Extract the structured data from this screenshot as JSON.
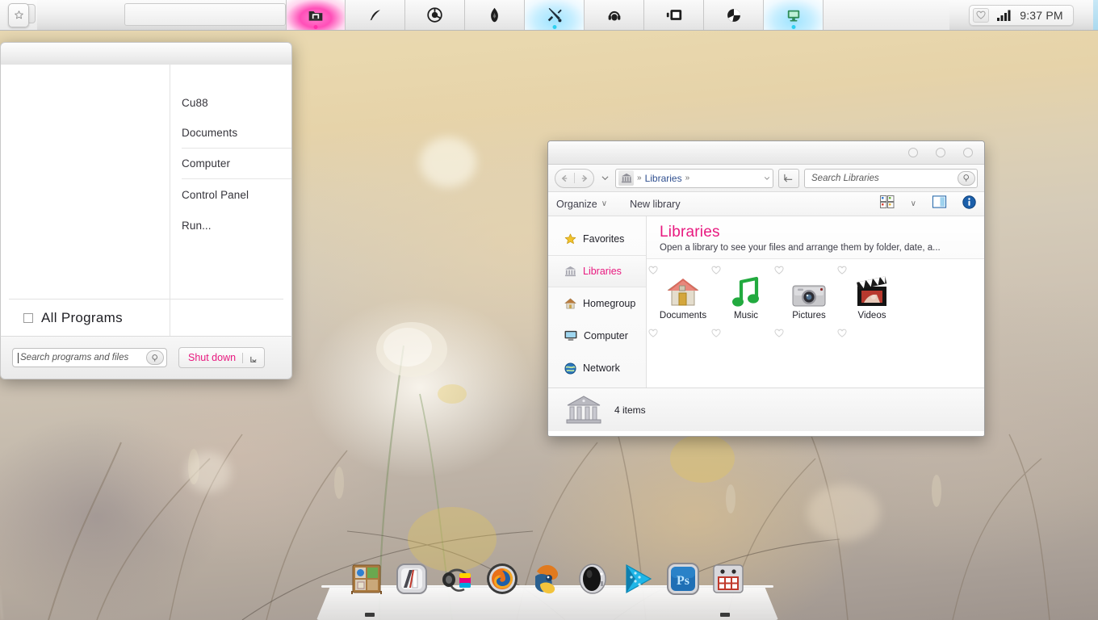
{
  "taskbar": {
    "start_button": {
      "name": "start-orb",
      "icon": "star-icon"
    },
    "buttons": [
      {
        "icon": "folder-icon",
        "label": "Explorer",
        "state": "active-pink"
      },
      {
        "icon": "feather-icon",
        "label": "Notes",
        "state": "normal"
      },
      {
        "icon": "chrome-icon",
        "label": "Chrome",
        "state": "normal"
      },
      {
        "icon": "flame-icon",
        "label": "Flame",
        "state": "normal"
      },
      {
        "icon": "tools-icon",
        "label": "Tools",
        "state": "active-blue"
      },
      {
        "icon": "headset-icon",
        "label": "Media",
        "state": "normal"
      },
      {
        "icon": "window-icon",
        "label": "Switcher",
        "state": "normal"
      },
      {
        "icon": "shutter-icon",
        "label": "Capture",
        "state": "normal"
      },
      {
        "icon": "terminal-icon",
        "label": "Terminal",
        "state": "active-blue"
      }
    ],
    "tray": {
      "heart_icon": "heart-icon",
      "signal_icon": "signal-bars-icon",
      "clock": "9:37 PM"
    }
  },
  "start_menu": {
    "right_items": [
      {
        "label": "Cu88",
        "divider": false
      },
      {
        "label": "Documents",
        "divider": true
      },
      {
        "label": "Computer",
        "divider": true
      },
      {
        "label": "Control Panel",
        "divider": false
      },
      {
        "label": "Run...",
        "divider": false
      }
    ],
    "all_programs": "All Programs",
    "search_placeholder": "Search programs and files",
    "search_value": "",
    "shutdown_label": "Shut down"
  },
  "explorer": {
    "window_controls": [
      "minimize",
      "maximize",
      "close"
    ],
    "address": {
      "back_icon": "arrow-left-icon",
      "forward_icon": "arrow-right-icon",
      "history_icon": "chevron-down-icon",
      "crumb_icon": "library-icon",
      "crumb_label": "Libraries",
      "sep_before": "»",
      "sep_after": "»",
      "dropdown_icon": "chevron-down-icon",
      "refresh_icon": "refresh-icon",
      "search_placeholder": "Search Libraries",
      "search_value": ""
    },
    "toolbar": {
      "organize_label": "Organize",
      "organize_caret": "∨",
      "new_library_label": "New library",
      "views_icon": "view-tiles-icon",
      "views_caret": "∨",
      "preview_icon": "preview-pane-icon",
      "help_icon": "help-info-icon"
    },
    "nav_pane": [
      {
        "label": "Favorites",
        "icon": "star-icon",
        "selected": false
      },
      {
        "label": "Libraries",
        "icon": "library-icon",
        "selected": true
      },
      {
        "label": "Homegroup",
        "icon": "home-icon",
        "selected": false
      },
      {
        "label": "Computer",
        "icon": "monitor-icon",
        "selected": false
      },
      {
        "label": "Network",
        "icon": "globe-icon",
        "selected": false
      }
    ],
    "content_header": {
      "title": "Libraries",
      "subtitle": "Open a library to see your files and arrange them by folder, date, a..."
    },
    "items": [
      {
        "label": "Documents",
        "icon": "house-folder-icon"
      },
      {
        "label": "Music",
        "icon": "music-note-icon"
      },
      {
        "label": "Pictures",
        "icon": "camera-icon"
      },
      {
        "label": "Videos",
        "icon": "clapperboard-icon"
      }
    ],
    "status": {
      "icon": "library-icon",
      "text": "4 items"
    }
  },
  "dock": {
    "items": [
      {
        "name": "shelf-app",
        "label": "Shelf"
      },
      {
        "name": "books-app",
        "label": "Books"
      },
      {
        "name": "headphones-app",
        "label": "Audio"
      },
      {
        "name": "firefox-app",
        "label": "Firefox"
      },
      {
        "name": "thunderbird-app",
        "label": "Thunderbird"
      },
      {
        "name": "helmet-app",
        "label": "Player"
      },
      {
        "name": "videoplayer-app",
        "label": "Video"
      },
      {
        "name": "photoshop-app",
        "label": "Ps"
      },
      {
        "name": "robot-app",
        "label": "Robot"
      }
    ]
  },
  "theme": {
    "accent_pink": "#e8197f",
    "accent_blue": "#2fd0ef",
    "taskbar_bg": "#efefef",
    "window_bg": "#ffffff",
    "text": "#23232b"
  }
}
